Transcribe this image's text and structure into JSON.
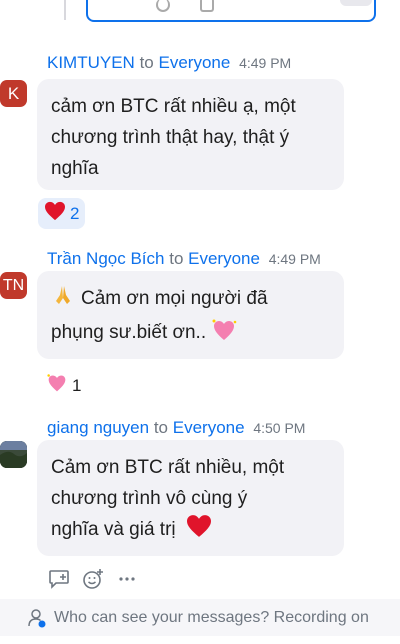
{
  "messages": [
    {
      "avatar": "K",
      "avatar_color": "#c0392b",
      "sender": "KIMTUYEN",
      "to": "to",
      "target": "Everyone",
      "time": "4:49 PM",
      "lines": [
        "cảm ơn BTC rất nhiều ạ, một",
        "chương trình thật hay, thật ý",
        "nghĩa"
      ],
      "reaction_icon": "heart-icon",
      "reaction_count": "2"
    },
    {
      "avatar": "TN",
      "avatar_color": "#c0392b",
      "sender": "Trần Ngọc Bích",
      "to": "to",
      "target": "Everyone",
      "time": "4:49 PM",
      "lines": [
        "Cảm ơn mọi người đã",
        "phụng sư.biết ơn.."
      ],
      "reaction_icon": "sparkling-heart-icon",
      "reaction_count": "1"
    },
    {
      "avatar": "",
      "sender": "giang nguyen",
      "to": "to",
      "target": "Everyone",
      "time": "4:50 PM",
      "lines": [
        "Cảm ơn BTC rất nhiều, một",
        "chương trình vô cùng ý",
        "nghĩa và giá trị"
      ]
    }
  ],
  "actions": [
    "reply-icon",
    "add-reaction-icon",
    "more-icon"
  ],
  "footer": {
    "text": "Who can see your messages? Recording on",
    "icon": "privacy-user-icon"
  },
  "colors": {
    "accent": "#0e71eb",
    "bubble": "#f2f2f6",
    "heart": "#e0142b"
  }
}
